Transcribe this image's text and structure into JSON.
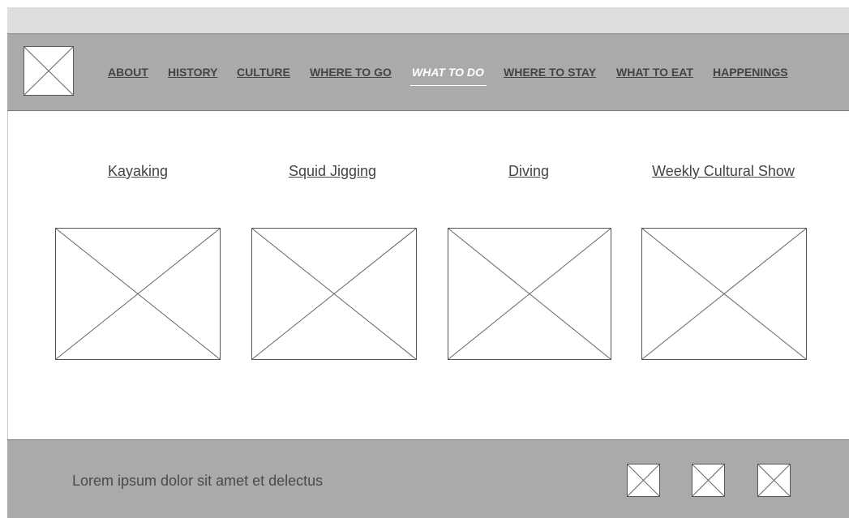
{
  "nav": {
    "items": [
      {
        "label": "ABOUT"
      },
      {
        "label": "HISTORY"
      },
      {
        "label": "CULTURE"
      },
      {
        "label": "WHERE TO GO"
      },
      {
        "label": "WHAT TO DO",
        "active": true
      },
      {
        "label": "WHERE TO STAY"
      },
      {
        "label": "WHAT TO EAT"
      },
      {
        "label": "HAPPENINGS"
      }
    ]
  },
  "activities": [
    {
      "title": "Kayaking"
    },
    {
      "title": "Squid Jigging"
    },
    {
      "title": "Diving"
    },
    {
      "title": "Weekly Cultural Show"
    }
  ],
  "footer": {
    "text": "Lorem ipsum dolor sit amet et delectus"
  },
  "colors": {
    "header_bg": "#aaaaaa",
    "top_strip": "#dedede",
    "link_text": "#444444",
    "active_link": "#ffffff"
  }
}
